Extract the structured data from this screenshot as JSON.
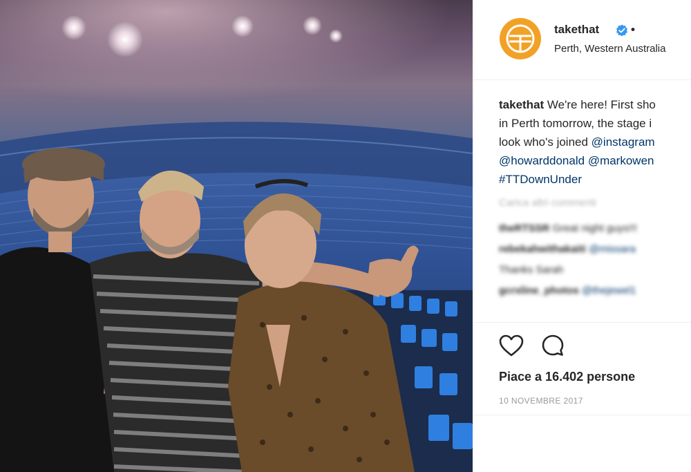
{
  "post": {
    "username": "takethat",
    "location": "Perth, Western Australia",
    "header_separator": "•",
    "caption": {
      "username": "takethat",
      "line1": "We're here! First sho",
      "line2": "in Perth tomorrow, the stage i",
      "line3_text": "look who's joined ",
      "line3_link": "@instagram",
      "line4_link_a": "@howarddonald",
      "line4_link_b": "@markowen",
      "line5_hashtag": "#TTDownUnder"
    },
    "comments_section": {
      "load_more": "Carica altri commenti",
      "comments": [
        {
          "user": "theRTSSR",
          "text": "Great night guys!!!"
        },
        {
          "user": "rebekahwithakaiti",
          "text": "@missara"
        },
        {
          "user": "",
          "text": "Thanks Sarah"
        },
        {
          "user": "gcrxline_photos",
          "text": "@thejewel1"
        }
      ]
    },
    "likes_text": "Piace a 16.402 persone",
    "date": "10 NOVEMBRE 2017"
  },
  "colors": {
    "avatar_bg": "#f2a127",
    "verified_blue": "#3897f0",
    "link_blue": "#003569",
    "date_gray": "#999999"
  },
  "icons": [
    "take-that-logo-icon",
    "verified-badge-icon",
    "heart-icon",
    "comment-bubble-icon"
  ]
}
